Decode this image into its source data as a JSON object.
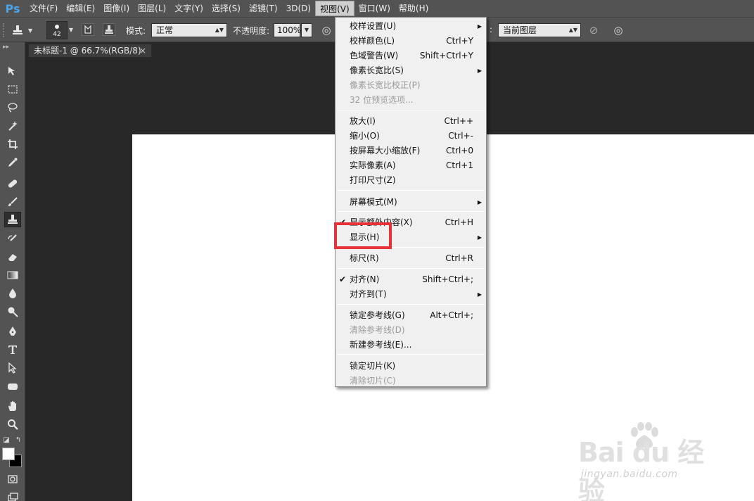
{
  "app": {
    "logo": "Ps"
  },
  "menubar": {
    "items": [
      "文件(F)",
      "编辑(E)",
      "图像(I)",
      "图层(L)",
      "文字(Y)",
      "选择(S)",
      "滤镜(T)",
      "3D(D)",
      "视图(V)",
      "窗口(W)",
      "帮助(H)"
    ],
    "active": "视图(V)"
  },
  "options": {
    "brush_size": "42",
    "mode_label": "模式:",
    "mode_value": "正常",
    "opacity_label": "不透明度:",
    "opacity_value": "100%",
    "sample_label": ":",
    "sample_value": "当前图层"
  },
  "document": {
    "tab_title": "未标题-1 @ 66.7%(RGB/8)",
    "close": "×"
  },
  "view_menu": {
    "items": [
      {
        "label": "校样设置(U)",
        "shortcut": "",
        "submenu": true,
        "disabled": false,
        "checked": false
      },
      {
        "label": "校样颜色(L)",
        "shortcut": "Ctrl+Y",
        "submenu": false,
        "disabled": false,
        "checked": false
      },
      {
        "label": "色域警告(W)",
        "shortcut": "Shift+Ctrl+Y",
        "submenu": false,
        "disabled": false,
        "checked": false
      },
      {
        "label": "像素长宽比(S)",
        "shortcut": "",
        "submenu": true,
        "disabled": false,
        "checked": false
      },
      {
        "label": "像素长宽比校正(P)",
        "shortcut": "",
        "submenu": false,
        "disabled": true,
        "checked": false
      },
      {
        "label": "32 位预览选项...",
        "shortcut": "",
        "submenu": false,
        "disabled": true,
        "checked": false
      },
      {
        "label": "放大(I)",
        "shortcut": "Ctrl++",
        "submenu": false,
        "disabled": false,
        "checked": false
      },
      {
        "label": "缩小(O)",
        "shortcut": "Ctrl+-",
        "submenu": false,
        "disabled": false,
        "checked": false
      },
      {
        "label": "按屏幕大小缩放(F)",
        "shortcut": "Ctrl+0",
        "submenu": false,
        "disabled": false,
        "checked": false
      },
      {
        "label": "实际像素(A)",
        "shortcut": "Ctrl+1",
        "submenu": false,
        "disabled": false,
        "checked": false
      },
      {
        "label": "打印尺寸(Z)",
        "shortcut": "",
        "submenu": false,
        "disabled": false,
        "checked": false
      },
      {
        "label": "屏幕模式(M)",
        "shortcut": "",
        "submenu": true,
        "disabled": false,
        "checked": false
      },
      {
        "label": "显示额外内容(X)",
        "shortcut": "Ctrl+H",
        "submenu": false,
        "disabled": false,
        "checked": true
      },
      {
        "label": "显示(H)",
        "shortcut": "",
        "submenu": true,
        "disabled": false,
        "checked": false
      },
      {
        "label": "标尺(R)",
        "shortcut": "Ctrl+R",
        "submenu": false,
        "disabled": false,
        "checked": false
      },
      {
        "label": "对齐(N)",
        "shortcut": "Shift+Ctrl+;",
        "submenu": false,
        "disabled": false,
        "checked": true
      },
      {
        "label": "对齐到(T)",
        "shortcut": "",
        "submenu": true,
        "disabled": false,
        "checked": false
      },
      {
        "label": "锁定参考线(G)",
        "shortcut": "Alt+Ctrl+;",
        "submenu": false,
        "disabled": false,
        "checked": false
      },
      {
        "label": "清除参考线(D)",
        "shortcut": "",
        "submenu": false,
        "disabled": true,
        "checked": false
      },
      {
        "label": "新建参考线(E)...",
        "shortcut": "",
        "submenu": false,
        "disabled": false,
        "checked": false
      },
      {
        "label": "锁定切片(K)",
        "shortcut": "",
        "submenu": false,
        "disabled": false,
        "checked": false
      },
      {
        "label": "清除切片(C)",
        "shortcut": "",
        "submenu": false,
        "disabled": true,
        "checked": false
      }
    ],
    "check_glyph": "✔",
    "submenu_glyph": "▶"
  },
  "watermark": {
    "logo": "Bai du 经验",
    "url": "jingyan.baidu.com"
  },
  "colors": {
    "highlight": "#e8323a",
    "panel": "#535353",
    "workspace": "#282828"
  }
}
